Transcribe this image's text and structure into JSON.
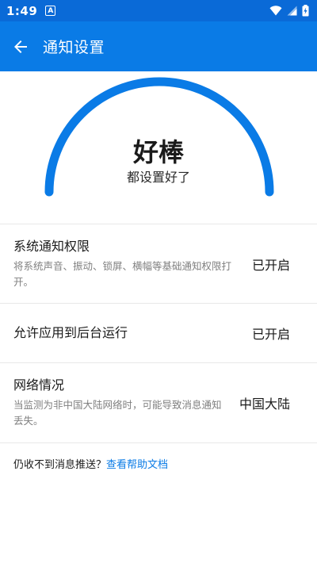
{
  "status_bar": {
    "time": "1:49",
    "notification_icon": "A"
  },
  "app_bar": {
    "title": "通知设置",
    "back_icon": "arrow-left-icon"
  },
  "hero": {
    "title": "好棒",
    "subtitle": "都设置好了",
    "gauge_color": "#0a7be6"
  },
  "settings": [
    {
      "title": "系统通知权限",
      "description": "将系统声音、振动、锁屏、横幅等基础通知权限打开。",
      "value": "已开启"
    },
    {
      "title": "允许应用到后台运行",
      "description": "",
      "value": "已开启"
    },
    {
      "title": "网络情况",
      "description": "当监测为非中国大陆网络时，可能导致消息通知丢失。",
      "value": "中国大陆"
    }
  ],
  "help": {
    "prompt": "仍收不到消息推送？",
    "link": "查看帮助文档"
  },
  "colors": {
    "primary": "#0a7be6",
    "status_bar": "#0a6ad7"
  }
}
